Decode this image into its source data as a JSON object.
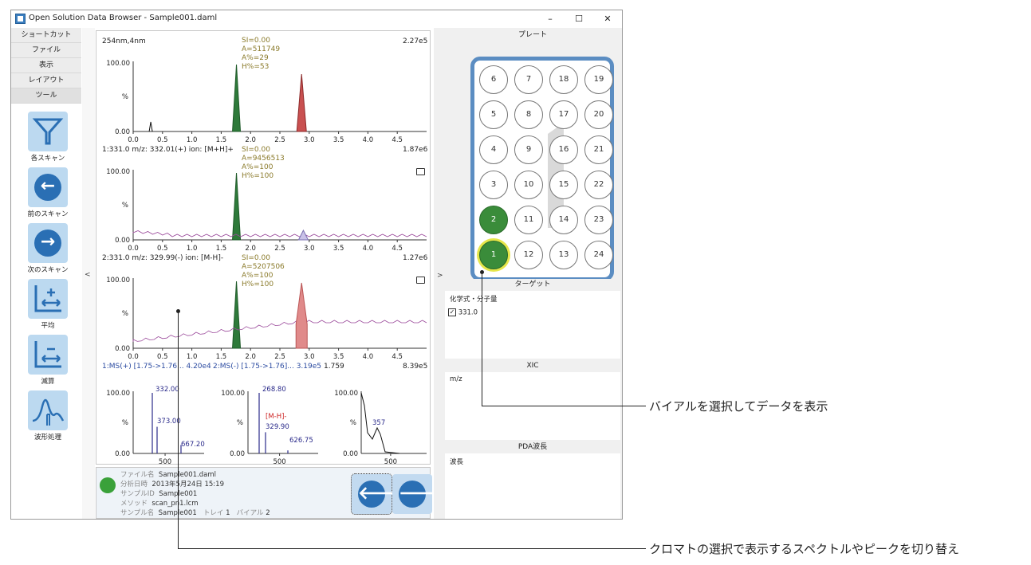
{
  "window": {
    "title": "Open Solution Data Browser - Sample001.daml",
    "controls": {
      "minimize": "–",
      "maximize": "☐",
      "close": "✕"
    }
  },
  "sidebar": {
    "tabs": [
      "ショートカット",
      "ファイル",
      "表示",
      "レイアウト",
      "ツール"
    ],
    "tools": [
      {
        "label": "各スキャン",
        "icon": "filter-icon"
      },
      {
        "label": "前のスキャン",
        "icon": "arrow-left-icon"
      },
      {
        "label": "次のスキャン",
        "icon": "arrow-right-icon"
      },
      {
        "label": "平均",
        "icon": "average-icon"
      },
      {
        "label": "減算",
        "icon": "subtract-icon"
      },
      {
        "label": "波形処理",
        "icon": "waveform-icon"
      }
    ]
  },
  "splitters": {
    "left": "<",
    "right": ">"
  },
  "chromatograms": [
    {
      "header": "254nm,4nm",
      "max": "2.27e5",
      "annotation": [
        "SI=0.00",
        "A=511749",
        "A%=29",
        "H%=53"
      ]
    },
    {
      "header": "1:331.0 m/z: 332.01(+) ion: [M+H]+",
      "max": "1.87e6",
      "annotation": [
        "SI=0.00",
        "A=9456513",
        "A%=100",
        "H%=100"
      ]
    },
    {
      "header": "2:331.0 m/z: 329.99(-) ion: [M-H]-",
      "max": "1.27e6",
      "annotation": [
        "SI=0.00",
        "A=5207506",
        "A%=100",
        "H%=100"
      ]
    }
  ],
  "chrom_axis": {
    "y_ticks": [
      "100.00",
      "%",
      "0.00"
    ],
    "x_ticks": [
      "0.0",
      "0.5",
      "1.0",
      "1.5",
      "2.0",
      "2.5",
      "3.0",
      "3.5",
      "4.0",
      "4.5"
    ]
  },
  "spectra_header": {
    "ms_pos": "1:MS(+) [1.75->1.76... 4.20e4",
    "ms_neg": "2:MS(-) [1.75->1.76]... 3.19e5",
    "pda_time": "1.759",
    "pda_max": "8.39e5"
  },
  "spectra": [
    {
      "y_ticks": [
        "100.00",
        "%",
        "0.00"
      ],
      "x_tick": "500",
      "labels": [
        "332.00",
        "373.00",
        "667.20"
      ]
    },
    {
      "y_ticks": [
        "100.00",
        "%",
        "0.00"
      ],
      "x_tick": "500",
      "labels": [
        "268.80",
        "[M-H]-",
        "329.90",
        "626.75"
      ]
    },
    {
      "y_ticks": [
        "100.00",
        "%",
        "0.00"
      ],
      "x_tick": "500",
      "labels": [
        "357"
      ]
    }
  ],
  "info": {
    "filename": {
      "key": "ファイル名",
      "value": "Sample001.daml"
    },
    "date": {
      "key": "分析日時",
      "value": "2013年5月24日 15:19"
    },
    "sample_id": {
      "key": "サンプルID",
      "value": "Sample001"
    },
    "method": {
      "key": "メソッド",
      "value": "scan_pn1.lcm"
    },
    "sample_name": {
      "key": "サンプル名",
      "value": "Sample001"
    },
    "tray_key": "トレイ",
    "tray": "1",
    "vial_key": "バイアル",
    "vial": "2"
  },
  "nav_buttons": {
    "prev": "🡐",
    "next": "🡒"
  },
  "plate": {
    "title": "プレート",
    "rows": [
      [
        "6",
        "7",
        "18",
        "19"
      ],
      [
        "5",
        "8",
        "17",
        "20"
      ],
      [
        "4",
        "9",
        "16",
        "21"
      ],
      [
        "3",
        "10",
        "15",
        "22"
      ],
      [
        "2",
        "11",
        "14",
        "23"
      ],
      [
        "1",
        "12",
        "13",
        "24"
      ]
    ],
    "active_wells": [
      "1",
      "2"
    ],
    "selected_well": "1"
  },
  "target": {
    "title": "ターゲット",
    "label": "化学式・分子量",
    "item": "331.0",
    "checked": true
  },
  "xic": {
    "title": "XIC",
    "label": "m/z"
  },
  "pda": {
    "title": "PDA波長",
    "label": "波長"
  },
  "callouts": {
    "vial": "バイアルを選択してデータを表示",
    "chrom": "クロマトの選択で表示するスペクトルやピークを切り替え"
  }
}
